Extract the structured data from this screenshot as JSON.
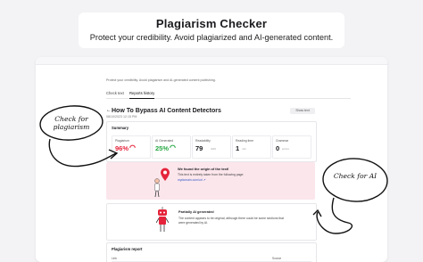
{
  "header": {
    "title": "Plagiarism Checker",
    "subtitle": "Protect your credibility. Avoid plagiarized and AI-generated content."
  },
  "app": {
    "intro": "Protect your credibility. Avoid plagiarism and AI-generated content publishing.",
    "tabs": [
      {
        "label": "Check text",
        "active": false
      },
      {
        "label": "Reports history",
        "active": true
      }
    ],
    "document": {
      "back_icon": "back-arrow-icon",
      "title": "How To Bypass AI Content Detectors",
      "date": "08/10/2023 12:15 PM",
      "show_text_label": "Show text"
    },
    "summary": {
      "label": "Summary",
      "metrics": [
        {
          "label": "Plagiarism",
          "value": "96%",
          "color": "#e5243b",
          "icon": "gauge-red-icon"
        },
        {
          "label": "AI Generated",
          "value": "25%",
          "color": "#27a844",
          "icon": "gauge-green-icon"
        },
        {
          "label": "Readability",
          "value": "79",
          "unit": "/100"
        },
        {
          "label": "Reading time",
          "value": "1",
          "unit": "min"
        },
        {
          "label": "Grammar",
          "value": "0",
          "unit": "errors"
        }
      ]
    },
    "origin": {
      "title": "We found the origin of the text!",
      "body": "This text is entirely taken from the following page:",
      "link": "mydomain.com/url",
      "icon": "location-pin-icon",
      "background": "#fbe6ec"
    },
    "ai_detection": {
      "title": "Partially AI generated",
      "body": "The content appears to be original, although there could be some sections that were generated by AI.",
      "icon": "robot-icon"
    },
    "report": {
      "title": "Plagiarism report",
      "columns": [
        "Link",
        "Source"
      ]
    }
  },
  "annotations": [
    {
      "text": "Check for plagiarism"
    },
    {
      "text": "Check for AI"
    }
  ],
  "colors": {
    "accent_red": "#e5243b",
    "accent_green": "#27a844",
    "link_blue": "#2f57c9"
  }
}
